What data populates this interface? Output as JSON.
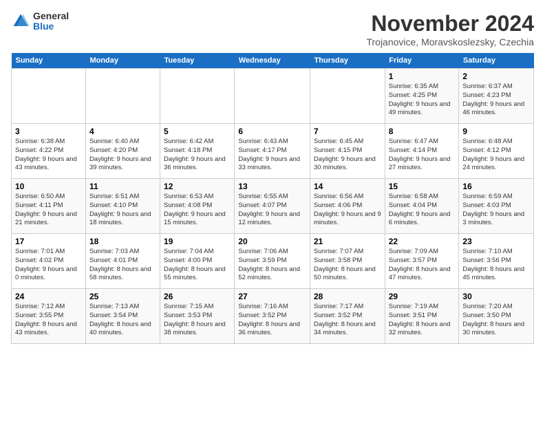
{
  "logo": {
    "general": "General",
    "blue": "Blue"
  },
  "title": "November 2024",
  "subtitle": "Trojanovice, Moravskoslezsky, Czechia",
  "days_of_week": [
    "Sunday",
    "Monday",
    "Tuesday",
    "Wednesday",
    "Thursday",
    "Friday",
    "Saturday"
  ],
  "weeks": [
    [
      {
        "day": "",
        "info": ""
      },
      {
        "day": "",
        "info": ""
      },
      {
        "day": "",
        "info": ""
      },
      {
        "day": "",
        "info": ""
      },
      {
        "day": "",
        "info": ""
      },
      {
        "day": "1",
        "info": "Sunrise: 6:35 AM\nSunset: 4:25 PM\nDaylight: 9 hours and 49 minutes."
      },
      {
        "day": "2",
        "info": "Sunrise: 6:37 AM\nSunset: 4:23 PM\nDaylight: 9 hours and 46 minutes."
      }
    ],
    [
      {
        "day": "3",
        "info": "Sunrise: 6:38 AM\nSunset: 4:22 PM\nDaylight: 9 hours and 43 minutes."
      },
      {
        "day": "4",
        "info": "Sunrise: 6:40 AM\nSunset: 4:20 PM\nDaylight: 9 hours and 39 minutes."
      },
      {
        "day": "5",
        "info": "Sunrise: 6:42 AM\nSunset: 4:18 PM\nDaylight: 9 hours and 36 minutes."
      },
      {
        "day": "6",
        "info": "Sunrise: 6:43 AM\nSunset: 4:17 PM\nDaylight: 9 hours and 33 minutes."
      },
      {
        "day": "7",
        "info": "Sunrise: 6:45 AM\nSunset: 4:15 PM\nDaylight: 9 hours and 30 minutes."
      },
      {
        "day": "8",
        "info": "Sunrise: 6:47 AM\nSunset: 4:14 PM\nDaylight: 9 hours and 27 minutes."
      },
      {
        "day": "9",
        "info": "Sunrise: 6:48 AM\nSunset: 4:12 PM\nDaylight: 9 hours and 24 minutes."
      }
    ],
    [
      {
        "day": "10",
        "info": "Sunrise: 6:50 AM\nSunset: 4:11 PM\nDaylight: 9 hours and 21 minutes."
      },
      {
        "day": "11",
        "info": "Sunrise: 6:51 AM\nSunset: 4:10 PM\nDaylight: 9 hours and 18 minutes."
      },
      {
        "day": "12",
        "info": "Sunrise: 6:53 AM\nSunset: 4:08 PM\nDaylight: 9 hours and 15 minutes."
      },
      {
        "day": "13",
        "info": "Sunrise: 6:55 AM\nSunset: 4:07 PM\nDaylight: 9 hours and 12 minutes."
      },
      {
        "day": "14",
        "info": "Sunrise: 6:56 AM\nSunset: 4:06 PM\nDaylight: 9 hours and 9 minutes."
      },
      {
        "day": "15",
        "info": "Sunrise: 6:58 AM\nSunset: 4:04 PM\nDaylight: 9 hours and 6 minutes."
      },
      {
        "day": "16",
        "info": "Sunrise: 6:59 AM\nSunset: 4:03 PM\nDaylight: 9 hours and 3 minutes."
      }
    ],
    [
      {
        "day": "17",
        "info": "Sunrise: 7:01 AM\nSunset: 4:02 PM\nDaylight: 9 hours and 0 minutes."
      },
      {
        "day": "18",
        "info": "Sunrise: 7:03 AM\nSunset: 4:01 PM\nDaylight: 8 hours and 58 minutes."
      },
      {
        "day": "19",
        "info": "Sunrise: 7:04 AM\nSunset: 4:00 PM\nDaylight: 8 hours and 55 minutes."
      },
      {
        "day": "20",
        "info": "Sunrise: 7:06 AM\nSunset: 3:59 PM\nDaylight: 8 hours and 52 minutes."
      },
      {
        "day": "21",
        "info": "Sunrise: 7:07 AM\nSunset: 3:58 PM\nDaylight: 8 hours and 50 minutes."
      },
      {
        "day": "22",
        "info": "Sunrise: 7:09 AM\nSunset: 3:57 PM\nDaylight: 8 hours and 47 minutes."
      },
      {
        "day": "23",
        "info": "Sunrise: 7:10 AM\nSunset: 3:56 PM\nDaylight: 8 hours and 45 minutes."
      }
    ],
    [
      {
        "day": "24",
        "info": "Sunrise: 7:12 AM\nSunset: 3:55 PM\nDaylight: 8 hours and 43 minutes."
      },
      {
        "day": "25",
        "info": "Sunrise: 7:13 AM\nSunset: 3:54 PM\nDaylight: 8 hours and 40 minutes."
      },
      {
        "day": "26",
        "info": "Sunrise: 7:15 AM\nSunset: 3:53 PM\nDaylight: 8 hours and 38 minutes."
      },
      {
        "day": "27",
        "info": "Sunrise: 7:16 AM\nSunset: 3:52 PM\nDaylight: 8 hours and 36 minutes."
      },
      {
        "day": "28",
        "info": "Sunrise: 7:17 AM\nSunset: 3:52 PM\nDaylight: 8 hours and 34 minutes."
      },
      {
        "day": "29",
        "info": "Sunrise: 7:19 AM\nSunset: 3:51 PM\nDaylight: 8 hours and 32 minutes."
      },
      {
        "day": "30",
        "info": "Sunrise: 7:20 AM\nSunset: 3:50 PM\nDaylight: 8 hours and 30 minutes."
      }
    ]
  ]
}
